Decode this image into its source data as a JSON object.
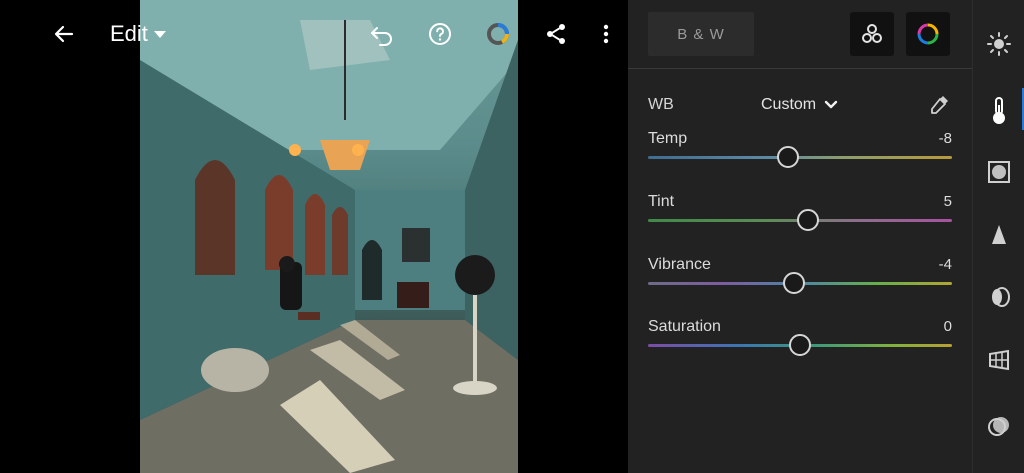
{
  "topbar": {
    "title": "Edit"
  },
  "panel": {
    "bw_label": "B & W",
    "wb": {
      "label": "WB",
      "value": "Custom"
    },
    "sliders": [
      {
        "label": "Temp",
        "value": "-8",
        "position": 0.46
      },
      {
        "label": "Tint",
        "value": "5",
        "position": 0.525
      },
      {
        "label": "Vibrance",
        "value": "-4",
        "position": 0.48
      },
      {
        "label": "Saturation",
        "value": "0",
        "position": 0.5
      }
    ]
  },
  "rail": {
    "items": [
      "light-icon",
      "color-temperature-icon",
      "effects-icon",
      "detail-icon",
      "optics-icon",
      "geometry-icon",
      "presets-icon"
    ],
    "active_index": 1,
    "accent_color": "#2a7bd8"
  },
  "colors": {
    "panel_bg": "#222222",
    "canvas_bg": "#000000"
  }
}
